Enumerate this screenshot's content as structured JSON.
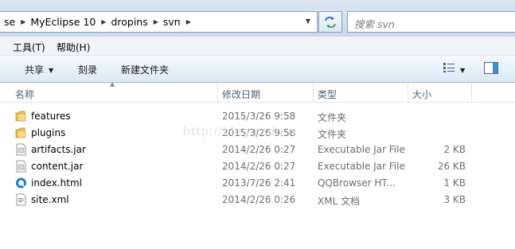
{
  "breadcrumb": [
    "se",
    "MyEclipse 10",
    "dropins",
    "svn"
  ],
  "search": {
    "placeholder": "搜索 svn"
  },
  "menu": [
    "工具(T)",
    "帮助(H)"
  ],
  "toolbar": {
    "share": "共享",
    "burn": "刻录",
    "new_folder": "新建文件夹"
  },
  "columns": {
    "name": "名称",
    "date": "修改日期",
    "type": "类型",
    "size": "大小"
  },
  "files": [
    {
      "name": "features",
      "date": "2015/3/26 9:58",
      "type": "文件夹",
      "size": "",
      "icon": "folder-icon"
    },
    {
      "name": "plugins",
      "date": "2015/3/26 9:58",
      "type": "文件夹",
      "size": "",
      "icon": "folder-icon"
    },
    {
      "name": "artifacts.jar",
      "date": "2014/2/26 0:27",
      "type": "Executable Jar File",
      "size": "2 KB",
      "icon": "jar-file-icon"
    },
    {
      "name": "content.jar",
      "date": "2014/2/26 0:27",
      "type": "Executable Jar File",
      "size": "26 KB",
      "icon": "jar-file-icon"
    },
    {
      "name": "index.html",
      "date": "2013/7/26 2:41",
      "type": "QQBrowser HT...",
      "size": "1 KB",
      "icon": "html-file-icon"
    },
    {
      "name": "site.xml",
      "date": "2014/2/26 0:26",
      "type": "XML 文档",
      "size": "3 KB",
      "icon": "xml-file-icon"
    }
  ],
  "watermark": "http://blog.csdn.n"
}
